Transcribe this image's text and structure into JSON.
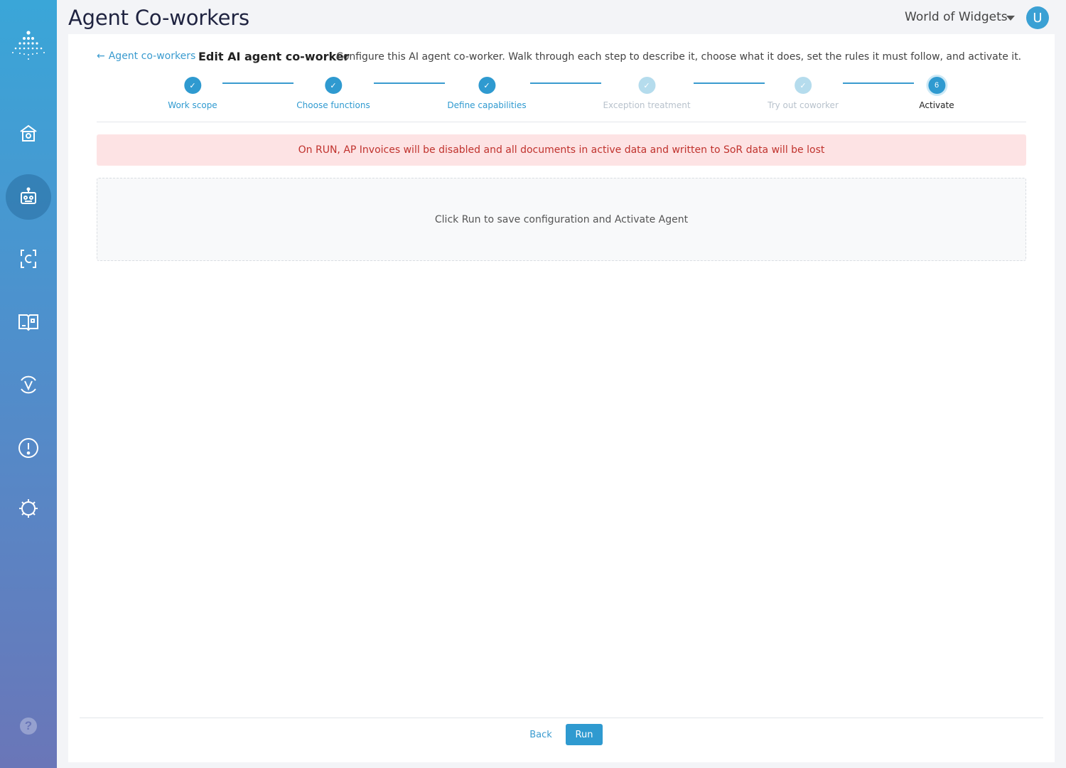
{
  "app": {
    "title": "Agent Co-workers",
    "org_name": "World of Widgets",
    "user_initial": "U"
  },
  "sidebar": {
    "items": [
      {
        "icon": "home-icon",
        "active": false
      },
      {
        "icon": "robot-icon",
        "active": true
      },
      {
        "icon": "document-c-icon",
        "active": false
      },
      {
        "icon": "book-icon",
        "active": false
      },
      {
        "icon": "validation-icon",
        "active": false
      },
      {
        "icon": "alert-icon",
        "active": false
      },
      {
        "icon": "settings-icon",
        "active": false
      }
    ],
    "help_label": "?"
  },
  "breadcrumb": {
    "arrow": "←",
    "back_label": "Agent co-workers"
  },
  "editor": {
    "title": "Edit AI agent co-worker",
    "description": "Configure this AI agent co-worker. Walk through each step to describe it, choose what it does, set the rules it must follow, and activate it."
  },
  "stepper": {
    "steps": [
      {
        "label": "Work scope",
        "state": "done",
        "symbol": "✓"
      },
      {
        "label": "Choose functions",
        "state": "done",
        "symbol": "✓"
      },
      {
        "label": "Define capabilities",
        "state": "done",
        "symbol": "✓"
      },
      {
        "label": "Exception treatment",
        "state": "pending",
        "symbol": "✓"
      },
      {
        "label": "Try out coworker",
        "state": "pending",
        "symbol": "✓"
      },
      {
        "label": "Activate",
        "state": "current",
        "symbol": "6"
      }
    ]
  },
  "alert": {
    "message": "On RUN, AP Invoices will be disabled and all documents in active data and written to SoR data will be lost",
    "color": "#c0322d"
  },
  "dropzone": {
    "message": "Click Run to save configuration and Activate Agent"
  },
  "footer": {
    "back_label": "Back",
    "run_label": "Run"
  },
  "colors": {
    "accent": "#2f9ad0",
    "sidebar_top": "#3aa6d8",
    "sidebar_bottom": "#6a76b8"
  }
}
